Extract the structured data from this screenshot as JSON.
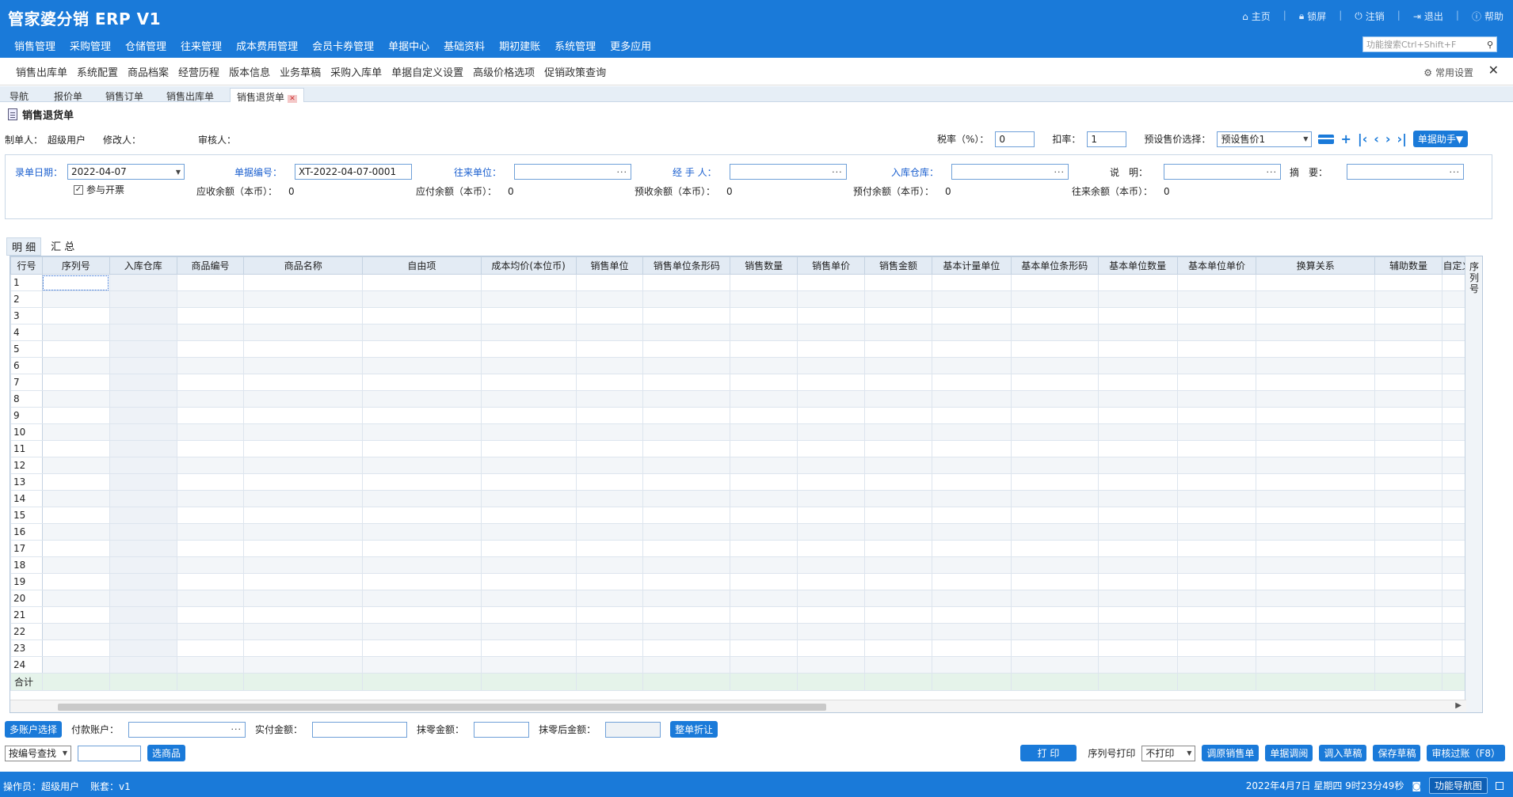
{
  "app": {
    "title": "管家婆分销 ERP V1",
    "top_actions": [
      "主页",
      "锁屏",
      "注销",
      "退出",
      "帮助"
    ],
    "func_search_placeholder": "功能搜索Ctrl+Shift+F"
  },
  "main_nav": [
    "销售管理",
    "采购管理",
    "仓储管理",
    "往来管理",
    "成本费用管理",
    "会员卡券管理",
    "单据中心",
    "基础资料",
    "期初建账",
    "系统管理",
    "更多应用"
  ],
  "submenu": {
    "items": [
      "销售出库单",
      "系统配置",
      "商品档案",
      "经营历程",
      "版本信息",
      "业务草稿",
      "采购入库单",
      "单据自定义设置",
      "高级价格选项",
      "促销政策查询"
    ],
    "settings": "常用设置"
  },
  "tabs": [
    "导航",
    "报价单",
    "销售订单",
    "销售出库单",
    "销售退货单"
  ],
  "doc": {
    "title": "销售退货单",
    "creator_label": "制单人：",
    "creator": "超级用户",
    "modifier_label": "修改人：",
    "modifier": "",
    "auditor_label": "审核人：",
    "auditor": "",
    "tax_label": "税率（%）：",
    "tax_value": "0",
    "discount_label": "扣率：",
    "discount_value": "1",
    "preset_price_label": "预设售价选择：",
    "preset_price_value": "预设售价1",
    "helper_btn": "单据助手▼"
  },
  "form": {
    "date_label": "录单日期：",
    "date_value": "2022-04-07",
    "docno_label": "单据编号：",
    "docno_value": "XT-2022-04-07-0001",
    "partner_label": "往来单位：",
    "handler_label": "经 手 人：",
    "warehouse_label": "入库仓库：",
    "note_label": "说　明：",
    "summary_label": "摘　要：",
    "invoice_label": "参与开票",
    "recv_label": "应收余额（本币）：",
    "recv_value": "0",
    "pay_label": "应付余额（本币）：",
    "pay_value": "0",
    "prerecv_label": "预收余额（本币）：",
    "prerecv_value": "0",
    "prepay_label": "预付余额（本币）：",
    "prepay_value": "0",
    "current_label": "往来余额（本币）：",
    "current_value": "0"
  },
  "detail_tabs": [
    "明 细",
    "汇 总"
  ],
  "grid": {
    "columns": [
      "行号",
      "序列号",
      "入库仓库",
      "商品编号",
      "商品名称",
      "自由项",
      "成本均价(本位币)",
      "销售单位",
      "销售单位条形码",
      "销售数量",
      "销售单价",
      "销售金额",
      "基本计量单位",
      "基本单位条形码",
      "基本单位数量",
      "基本单位单价",
      "换算关系",
      "辅助数量",
      "自定义辅"
    ],
    "rows": [
      "1",
      "2",
      "3",
      "4",
      "5",
      "6",
      "7",
      "8",
      "9",
      "10",
      "11",
      "12",
      "13",
      "14",
      "15",
      "16",
      "17",
      "18",
      "19",
      "20",
      "21",
      "22",
      "23",
      "24"
    ],
    "total_label": "合计",
    "side_label": "序列号"
  },
  "bottom": {
    "multi_account_btn": "多账户选择",
    "pay_account_label": "付款账户：",
    "actual_pay_label": "实付金额：",
    "wipe_label": "抹零金额：",
    "after_wipe_label": "抹零后金额：",
    "whole_discount_btn": "整单折让",
    "search_by_value": "按编号查找",
    "select_goods_btn": "选商品",
    "print_btn": "打 印",
    "serial_print_label": "序列号打印",
    "serial_print_value": "不打印",
    "actions": [
      "调原销售单",
      "单据调阅",
      "调入草稿",
      "保存草稿",
      "审核过账（F8）"
    ]
  },
  "status": {
    "operator_label": "操作员：",
    "operator": "超级用户",
    "account_label": "账套：",
    "account": "v1",
    "datetime": "2022年4月7日 星期四 9时23分49秒",
    "nav_map_btn": "功能导航图"
  },
  "colors": {
    "primary": "#1a7ad9",
    "blue_label": "#1a5fcf",
    "total_row": "#e5f3ea"
  }
}
